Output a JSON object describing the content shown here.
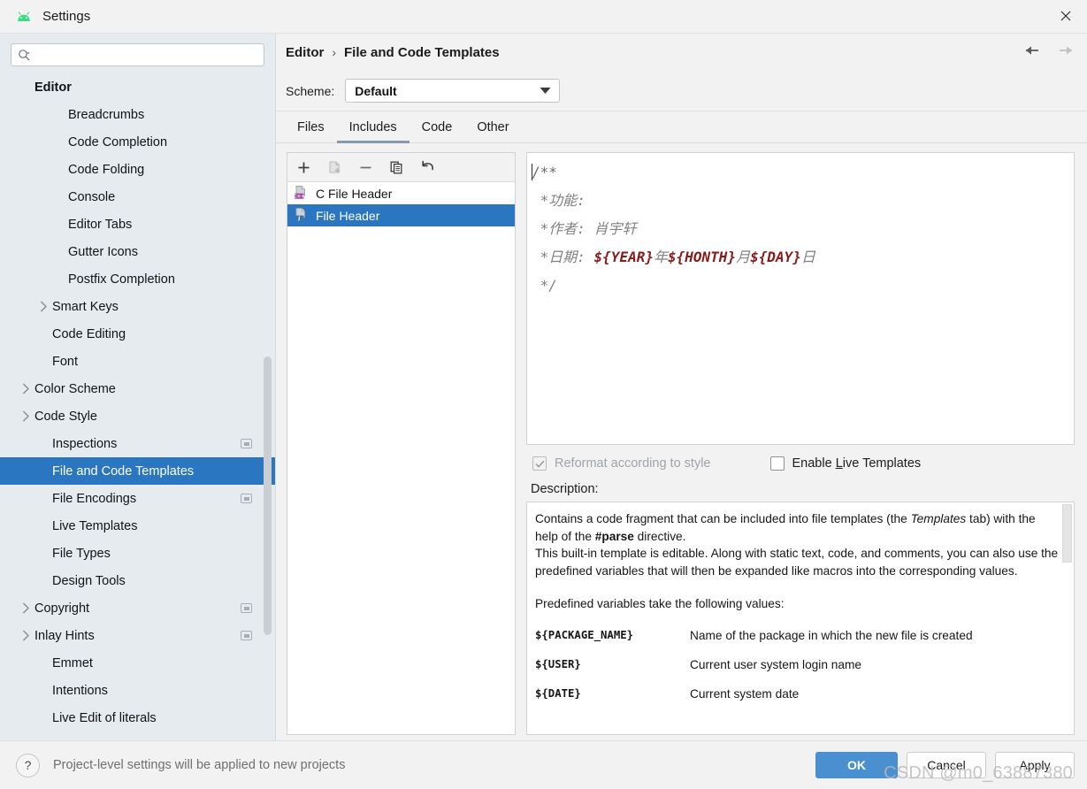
{
  "window": {
    "title": "Settings",
    "app_icon": "android-logo-icon",
    "close_icon": "close-icon"
  },
  "sidebar": {
    "search": {
      "placeholder": "",
      "value": "",
      "icon": "search-icon"
    },
    "items": [
      {
        "label": "Editor",
        "level": 0,
        "group": true,
        "arrow": false,
        "selected": false,
        "indicator": false
      },
      {
        "label": "Breadcrumbs",
        "level": 2,
        "group": false,
        "arrow": false,
        "selected": false,
        "indicator": false
      },
      {
        "label": "Code Completion",
        "level": 2,
        "group": false,
        "arrow": false,
        "selected": false,
        "indicator": false
      },
      {
        "label": "Code Folding",
        "level": 2,
        "group": false,
        "arrow": false,
        "selected": false,
        "indicator": false
      },
      {
        "label": "Console",
        "level": 2,
        "group": false,
        "arrow": false,
        "selected": false,
        "indicator": false
      },
      {
        "label": "Editor Tabs",
        "level": 2,
        "group": false,
        "arrow": false,
        "selected": false,
        "indicator": false
      },
      {
        "label": "Gutter Icons",
        "level": 2,
        "group": false,
        "arrow": false,
        "selected": false,
        "indicator": false
      },
      {
        "label": "Postfix Completion",
        "level": 2,
        "group": false,
        "arrow": false,
        "selected": false,
        "indicator": false
      },
      {
        "label": "Smart Keys",
        "level": 1,
        "group": false,
        "arrow": true,
        "selected": false,
        "indicator": false
      },
      {
        "label": "Code Editing",
        "level": 1,
        "group": false,
        "arrow": false,
        "selected": false,
        "indicator": false
      },
      {
        "label": "Font",
        "level": 1,
        "group": false,
        "arrow": false,
        "selected": false,
        "indicator": false
      },
      {
        "label": "Color Scheme",
        "level": 0,
        "group": false,
        "arrow": true,
        "selected": false,
        "indicator": false
      },
      {
        "label": "Code Style",
        "level": 0,
        "group": false,
        "arrow": true,
        "selected": false,
        "indicator": false
      },
      {
        "label": "Inspections",
        "level": 1,
        "group": false,
        "arrow": false,
        "selected": false,
        "indicator": true
      },
      {
        "label": "File and Code Templates",
        "level": 1,
        "group": false,
        "arrow": false,
        "selected": true,
        "indicator": false
      },
      {
        "label": "File Encodings",
        "level": 1,
        "group": false,
        "arrow": false,
        "selected": false,
        "indicator": true
      },
      {
        "label": "Live Templates",
        "level": 1,
        "group": false,
        "arrow": false,
        "selected": false,
        "indicator": false
      },
      {
        "label": "File Types",
        "level": 1,
        "group": false,
        "arrow": false,
        "selected": false,
        "indicator": false
      },
      {
        "label": "Design Tools",
        "level": 1,
        "group": false,
        "arrow": false,
        "selected": false,
        "indicator": false
      },
      {
        "label": "Copyright",
        "level": 0,
        "group": false,
        "arrow": true,
        "selected": false,
        "indicator": true
      },
      {
        "label": "Inlay Hints",
        "level": 0,
        "group": false,
        "arrow": true,
        "selected": false,
        "indicator": true
      },
      {
        "label": "Emmet",
        "level": 1,
        "group": false,
        "arrow": false,
        "selected": false,
        "indicator": false
      },
      {
        "label": "Intentions",
        "level": 1,
        "group": false,
        "arrow": false,
        "selected": false,
        "indicator": false
      },
      {
        "label": "Live Edit of literals",
        "level": 1,
        "group": false,
        "arrow": false,
        "selected": false,
        "indicator": false
      }
    ]
  },
  "header": {
    "breadcrumb": [
      "Editor",
      "File and Code Templates"
    ],
    "separator": "›",
    "back_icon": "arrow-left-icon",
    "forward_icon": "arrow-right-icon"
  },
  "scheme": {
    "label": "Scheme:",
    "value": "Default",
    "caret_icon": "chevron-down-icon"
  },
  "tabs": [
    {
      "label": "Files",
      "active": false
    },
    {
      "label": "Includes",
      "active": true
    },
    {
      "label": "Code",
      "active": false
    },
    {
      "label": "Other",
      "active": false
    }
  ],
  "list_toolbar": [
    {
      "name": "add-template-button",
      "icon": "plus-icon",
      "enabled": true
    },
    {
      "name": "create-from-file-button",
      "icon": "file-add-icon",
      "enabled": false
    },
    {
      "name": "remove-template-button",
      "icon": "minus-icon",
      "enabled": true
    },
    {
      "name": "copy-template-button",
      "icon": "copy-icon",
      "enabled": true
    },
    {
      "name": "reset-template-button",
      "icon": "undo-icon",
      "enabled": true
    }
  ],
  "template_list": [
    {
      "label": "C File Header",
      "badge": "C++",
      "badge_color": "#a64ca6",
      "selected": false
    },
    {
      "label": "File Header",
      "badge": "J",
      "badge_color": "#3574b3",
      "selected": true
    }
  ],
  "editor": {
    "lines": [
      {
        "segments": [
          {
            "text": "/**",
            "style": "plain"
          }
        ]
      },
      {
        "segments": [
          {
            "text": " *功能:",
            "style": "comment"
          }
        ]
      },
      {
        "segments": [
          {
            "text": " *作者: 肖宇轩",
            "style": "comment"
          }
        ]
      },
      {
        "segments": [
          {
            "text": " *日期: ",
            "style": "comment"
          },
          {
            "text": "${YEAR}",
            "style": "macro"
          },
          {
            "text": "年",
            "style": "comment"
          },
          {
            "text": "${HONTH}",
            "style": "macro"
          },
          {
            "text": "月",
            "style": "comment"
          },
          {
            "text": "${DAY}",
            "style": "macro"
          },
          {
            "text": "日",
            "style": "comment"
          }
        ]
      },
      {
        "segments": [
          {
            "text": " */",
            "style": "comment"
          }
        ]
      }
    ]
  },
  "options": {
    "reformat": {
      "label": "Reformat according to style",
      "checked": true,
      "enabled": false,
      "check_icon": "checkmark-icon"
    },
    "live_templates": {
      "label_before": "Enable ",
      "mnemonic": "L",
      "label_after": "ive Templates",
      "checked": false,
      "enabled": true
    }
  },
  "description": {
    "title": "Description:",
    "paragraphs": [
      "Contains a code fragment that can be included into file templates (the Templates tab) with the help of the #parse directive.",
      "This built-in template is editable. Along with static text, code, and comments, you can also use the predefined variables that will then be expanded like macros into the corresponding values.",
      "Predefined variables take the following values:"
    ],
    "variables": [
      {
        "name": "${PACKAGE_NAME}",
        "desc": "Name of the package in which the new file is created"
      },
      {
        "name": "${USER}",
        "desc": "Current user system login name"
      },
      {
        "name": "${DATE}",
        "desc": "Current system date"
      }
    ]
  },
  "footer": {
    "help_icon": "question-mark-icon",
    "note": "Project-level settings will be applied to new projects",
    "buttons": [
      {
        "label": "OK",
        "primary": true
      },
      {
        "label": "Cancel",
        "primary": false
      },
      {
        "label": "Apply",
        "primary": false
      }
    ]
  },
  "watermark": "CSDN @m0_63887380",
  "colors": {
    "selection": "#2a76c0",
    "primary_button": "#4a8fd0",
    "sidebar_bg": "#e6ebef",
    "macro_text": "#871c1c"
  }
}
